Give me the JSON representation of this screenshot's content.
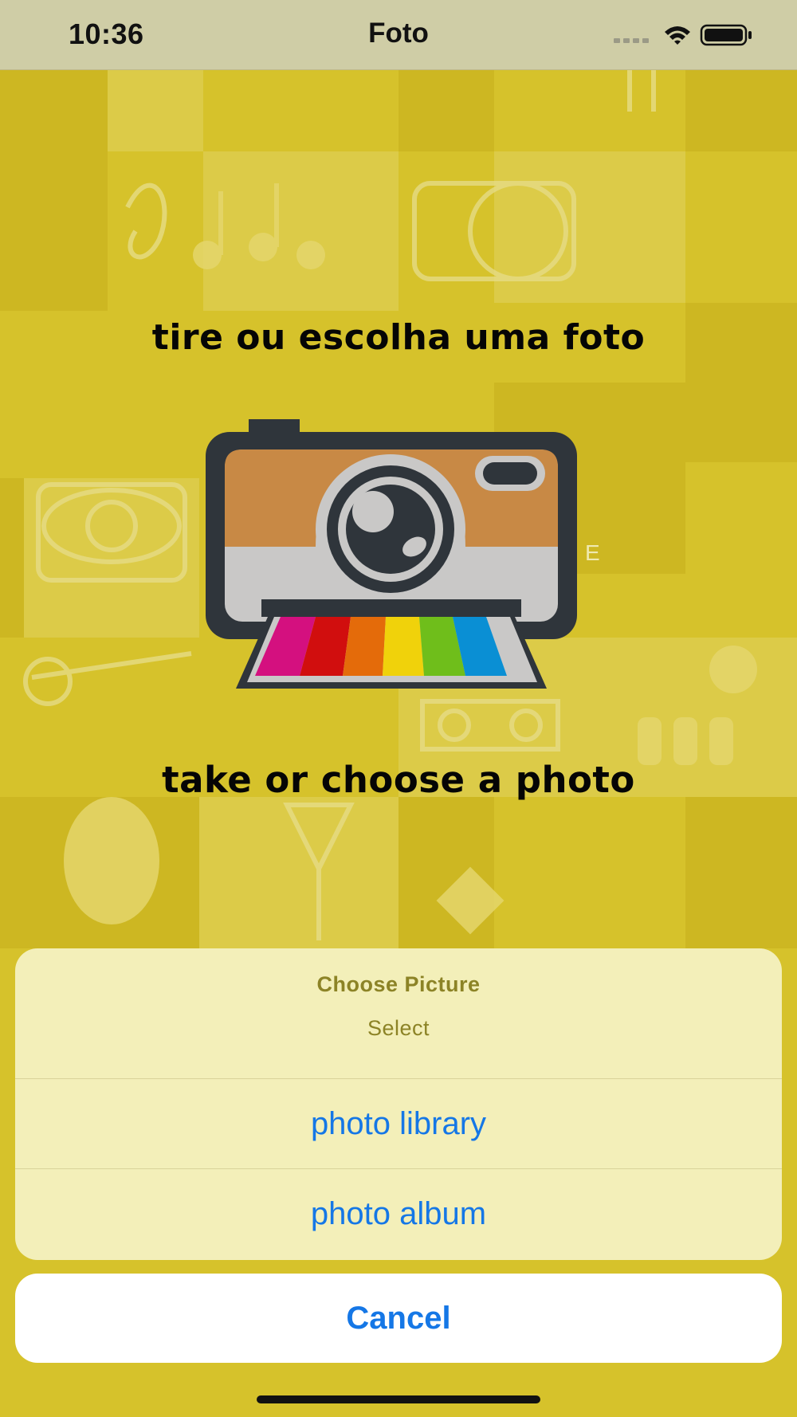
{
  "status_bar": {
    "time": "10:36",
    "title": "Foto",
    "icons": [
      "signal-dots-icon",
      "wifi-icon",
      "battery-icon"
    ]
  },
  "main": {
    "headline_pt": "tire ou escolha uma foto",
    "headline_en": "take or choose a photo",
    "stray_letter": "E",
    "illustration": "camera-icon"
  },
  "action_sheet": {
    "title": "Choose Picture",
    "subtitle": "Select",
    "options": [
      {
        "label": "photo library"
      },
      {
        "label": "photo album"
      }
    ],
    "cancel_label": "Cancel"
  },
  "colors": {
    "background": "#d6c22b",
    "status_bar": "#cfcda6",
    "sheet": "#f3efb9",
    "accent_blue": "#1577e6",
    "sheet_header_text": "#8c8326"
  }
}
